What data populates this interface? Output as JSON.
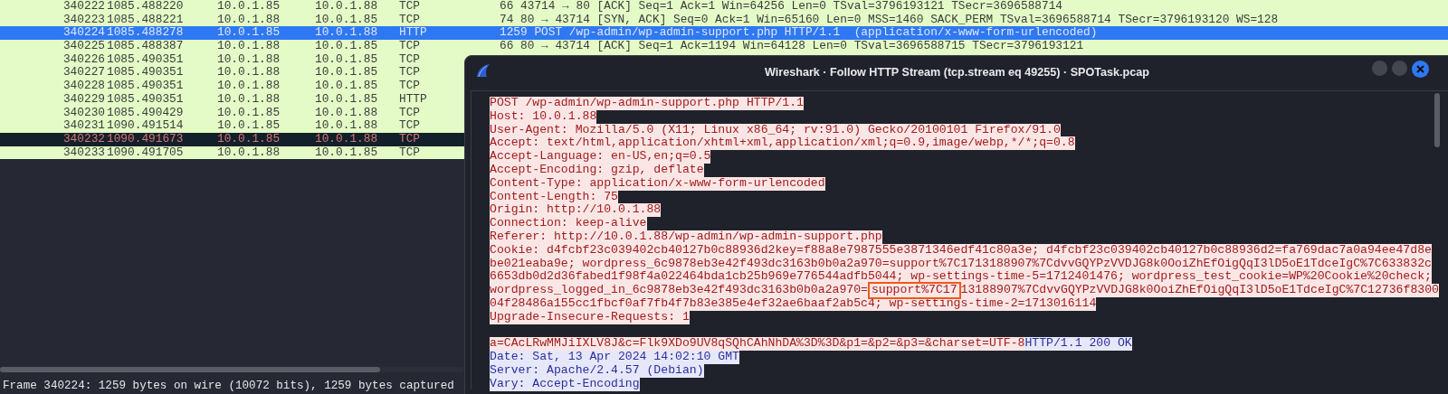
{
  "packet_list": {
    "rows": [
      {
        "no": "340222",
        "time": "1085.488220",
        "source": "10.0.1.85",
        "destination": "10.0.1.88",
        "protocol": "TCP",
        "length": "66",
        "info": "43714 → 80 [ACK] Seq=1 Ack=1 Win=64256 Len=0 TSval=3796193121 TSecr=3696588714",
        "selected": false,
        "kind": "normal"
      },
      {
        "no": "340223",
        "time": "1085.488221",
        "source": "10.0.1.88",
        "destination": "10.0.1.85",
        "protocol": "TCP",
        "length": "74",
        "info": "80 → 43714 [SYN, ACK] Seq=0 Ack=1 Win=65160 Len=0 MSS=1460 SACK_PERM TSval=3696588714 TSecr=3796193120 WS=128",
        "selected": false,
        "kind": "normal"
      },
      {
        "no": "340224",
        "time": "1085.488278",
        "source": "10.0.1.85",
        "destination": "10.0.1.88",
        "protocol": "HTTP",
        "length": "1259",
        "info": "POST /wp-admin/wp-admin-support.php HTTP/1.1  (application/x-www-form-urlencoded)",
        "selected": true,
        "kind": "normal"
      },
      {
        "no": "340225",
        "time": "1085.488387",
        "source": "10.0.1.88",
        "destination": "10.0.1.85",
        "protocol": "TCP",
        "length": "66",
        "info": "80 → 43714 [ACK] Seq=1 Ack=1194 Win=64128 Len=0 TSval=3696588715 TSecr=3796193121",
        "selected": false,
        "kind": "normal"
      },
      {
        "no": "340226",
        "time": "1085.490351",
        "source": "10.0.1.88",
        "destination": "10.0.1.85",
        "protocol": "TCP",
        "selected": false,
        "kind": "normal"
      },
      {
        "no": "340227",
        "time": "1085.490351",
        "source": "10.0.1.88",
        "destination": "10.0.1.85",
        "protocol": "TCP",
        "selected": false,
        "kind": "normal"
      },
      {
        "no": "340228",
        "time": "1085.490351",
        "source": "10.0.1.88",
        "destination": "10.0.1.85",
        "protocol": "TCP",
        "selected": false,
        "kind": "normal"
      },
      {
        "no": "340229",
        "time": "1085.490351",
        "source": "10.0.1.88",
        "destination": "10.0.1.85",
        "protocol": "HTTP",
        "selected": false,
        "kind": "normal"
      },
      {
        "no": "340230",
        "time": "1085.490429",
        "source": "10.0.1.85",
        "destination": "10.0.1.88",
        "protocol": "TCP",
        "selected": false,
        "kind": "normal"
      },
      {
        "no": "340231",
        "time": "1090.491514",
        "source": "10.0.1.85",
        "destination": "10.0.1.88",
        "protocol": "TCP",
        "selected": false,
        "kind": "normal"
      },
      {
        "no": "340232",
        "time": "1090.491673",
        "source": "10.0.1.85",
        "destination": "10.0.1.88",
        "protocol": "TCP",
        "selected": false,
        "kind": "alert"
      },
      {
        "no": "340233",
        "time": "1090.491705",
        "source": "10.0.1.88",
        "destination": "10.0.1.85",
        "protocol": "TCP",
        "selected": false,
        "kind": "normal"
      }
    ]
  },
  "status_bar": {
    "text": "Frame 340224: 1259 bytes on wire (10072 bits), 1259 bytes captured"
  },
  "stream_window": {
    "title": "Wireshark · Follow HTTP Stream (tcp.stream eq 49255) · SPOTask.pcap",
    "lines": [
      {
        "kind": "text",
        "segments": [
          {
            "text": "POST /wp-admin/wp-admin-support.php HTTP/1.1",
            "kind": "client",
            "highlighted": false
          }
        ]
      },
      {
        "kind": "text",
        "segments": [
          {
            "text": "Host: 10.0.1.88",
            "kind": "client",
            "highlighted": false
          }
        ]
      },
      {
        "kind": "text",
        "segments": [
          {
            "text": "User-Agent: Mozilla/5.0 (X11; Linux x86_64; rv:91.0) Gecko/20100101 Firefox/91.0",
            "kind": "client",
            "highlighted": false
          }
        ]
      },
      {
        "kind": "text",
        "segments": [
          {
            "text": "Accept: text/html,application/xhtml+xml,application/xml;q=0.9,image/webp,*/*;q=0.8",
            "kind": "client",
            "highlighted": false
          }
        ]
      },
      {
        "kind": "text",
        "segments": [
          {
            "text": "Accept-Language: en-US,en;q=0.5",
            "kind": "client",
            "highlighted": false
          }
        ]
      },
      {
        "kind": "text",
        "segments": [
          {
            "text": "Accept-Encoding: gzip, deflate",
            "kind": "client",
            "highlighted": false
          }
        ]
      },
      {
        "kind": "text",
        "segments": [
          {
            "text": "Content-Type: application/x-www-form-urlencoded",
            "kind": "client",
            "highlighted": false
          }
        ]
      },
      {
        "kind": "text",
        "segments": [
          {
            "text": "Content-Length: 75",
            "kind": "client",
            "highlighted": false
          }
        ]
      },
      {
        "kind": "text",
        "segments": [
          {
            "text": "Origin: http://10.0.1.88",
            "kind": "client",
            "highlighted": false
          }
        ]
      },
      {
        "kind": "text",
        "segments": [
          {
            "text": "Connection: keep-alive",
            "kind": "client",
            "highlighted": false
          }
        ]
      },
      {
        "kind": "text",
        "segments": [
          {
            "text": "Referer: http://10.0.1.88/wp-admin/wp-admin-support.php",
            "kind": "client",
            "highlighted": false
          }
        ]
      },
      {
        "kind": "text",
        "segments": [
          {
            "text": "Cookie: d4fcbf23c039402cb40127b0c88936d2key=f88a8e7987555e3871346edf41c80a3e; d4fcbf23c039402cb40127b0c88936d2=fa769dac7a0a94ee47d8e",
            "kind": "client",
            "highlighted": false
          }
        ]
      },
      {
        "kind": "text",
        "segments": [
          {
            "text": "be021eaba9e; wordpress_6c9878eb3e42f493dc3163b0b0a2a970=support%7C1713188907%7CdvvGQYPzVVDJG8k0OoiZhEfOigQqI3lD5oE1TdceIgC%7C633832c",
            "kind": "client",
            "highlighted": false
          }
        ]
      },
      {
        "kind": "text",
        "segments": [
          {
            "text": "6653db0d2d36fabed1f98f4a022464bda1cb25b969e776544adfb5044; wp-settings-time-5=1712401476; wordpress_test_cookie=WP%20Cookie%20check;",
            "kind": "client",
            "highlighted": false
          }
        ]
      },
      {
        "kind": "text",
        "segments": [
          {
            "text": "wordpress_logged_in_6c9878eb3e42f493dc3163b0b0a2a970=",
            "kind": "client",
            "highlighted": false
          },
          {
            "text": "support%7C17",
            "kind": "client",
            "highlighted": true
          },
          {
            "text": "13188907%7CdvvGQYPzVVDJG8k0OoiZhEfOigQqI3lD5oE1TdceIgC%7C12736f8300",
            "kind": "client",
            "highlighted": false
          }
        ]
      },
      {
        "kind": "text",
        "segments": [
          {
            "text": "04f28486a155cc1fbcf0af7fb4f7b83e385e4ef32ae6baaf2ab5c4; wp-settings-time-2=1713016114",
            "kind": "client",
            "highlighted": false
          }
        ]
      },
      {
        "kind": "text",
        "segments": [
          {
            "text": "Upgrade-Insecure-Requests: 1",
            "kind": "client",
            "highlighted": false
          }
        ]
      },
      {
        "kind": "blank"
      },
      {
        "kind": "text",
        "segments": [
          {
            "text": "a=CAcLRwMMJiIXLV8J&c=Flk9XDo9UV8qSQhCAhNhDA%3D%3D&p1=&p2=&p3=&charset=UTF-8",
            "kind": "client",
            "highlighted": false
          },
          {
            "text": "HTTP/1.1 200 OK",
            "kind": "server",
            "highlighted": false
          }
        ]
      },
      {
        "kind": "text",
        "segments": [
          {
            "text": "Date: Sat, 13 Apr 2024 14:02:10 GMT",
            "kind": "server",
            "highlighted": false
          }
        ]
      },
      {
        "kind": "text",
        "segments": [
          {
            "text": "Server: Apache/2.4.57 (Debian)",
            "kind": "server",
            "highlighted": false
          }
        ]
      },
      {
        "kind": "text",
        "segments": [
          {
            "text": "Vary: Accept-Encoding",
            "kind": "server",
            "highlighted": false
          }
        ]
      }
    ]
  }
}
